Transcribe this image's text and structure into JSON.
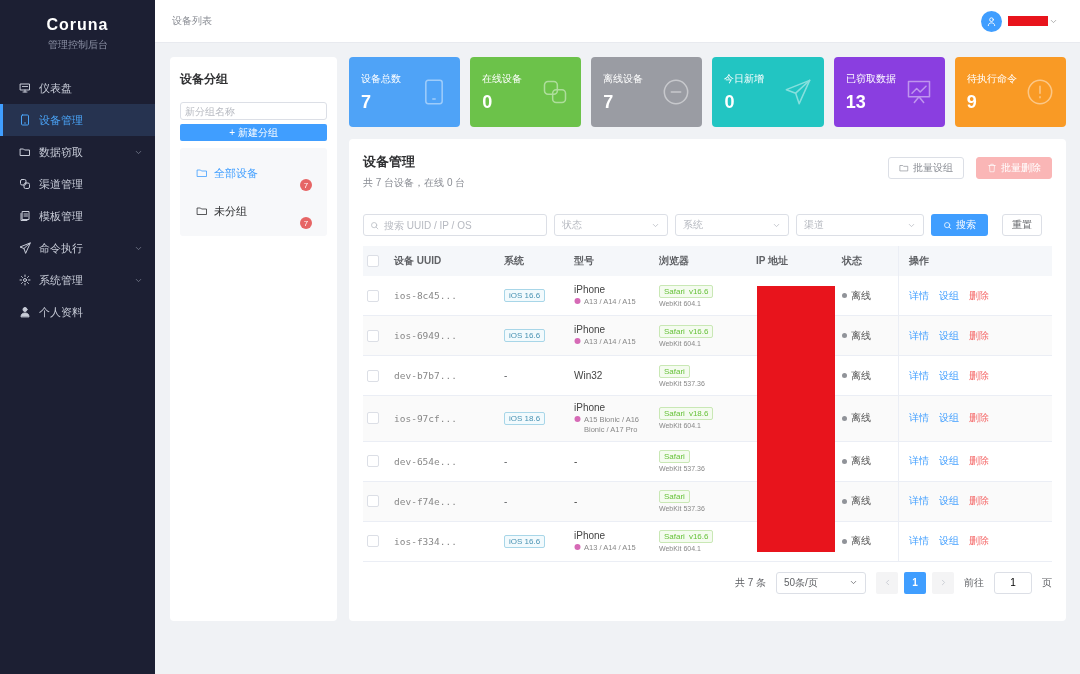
{
  "brand": {
    "title": "Coruna",
    "subtitle": "管理控制后台"
  },
  "sidebar": {
    "items": [
      {
        "label": "仪表盘",
        "selected": false,
        "expandable": false
      },
      {
        "label": "设备管理",
        "selected": true,
        "expandable": false
      },
      {
        "label": "数据窃取",
        "selected": false,
        "expandable": true
      },
      {
        "label": "渠道管理",
        "selected": false,
        "expandable": false
      },
      {
        "label": "模板管理",
        "selected": false,
        "expandable": false
      },
      {
        "label": "命令执行",
        "selected": false,
        "expandable": true
      },
      {
        "label": "系统管理",
        "selected": false,
        "expandable": true
      },
      {
        "label": "个人资料",
        "selected": false,
        "expandable": false
      }
    ]
  },
  "topbar": {
    "breadcrumb": "设备列表",
    "user_redacted": true
  },
  "groups": {
    "title": "设备分组",
    "input_placeholder": "新分组名称",
    "add_button": "+ 新建分组",
    "items": [
      {
        "label": "全部设备",
        "count": "7",
        "selected": true
      },
      {
        "label": "未分组",
        "count": "7",
        "selected": false
      }
    ]
  },
  "stats": [
    {
      "label": "设备总数",
      "value": "7",
      "color": "#4fa3f7"
    },
    {
      "label": "在线设备",
      "value": "0",
      "color": "#6cc24a"
    },
    {
      "label": "离线设备",
      "value": "7",
      "color": "#9a9ca3"
    },
    {
      "label": "今日新增",
      "value": "0",
      "color": "#22c5c2"
    },
    {
      "label": "已窃取数据",
      "value": "13",
      "color": "#8a3ee0"
    },
    {
      "label": "待执行命令",
      "value": "9",
      "color": "#f99a25"
    }
  ],
  "devices": {
    "title": "设备管理",
    "subtitle": "共 7 台设备，在线 0 台",
    "buttons": [
      {
        "label": "批量设组",
        "disabled": false,
        "kind": "plain"
      },
      {
        "label": "批量删除",
        "disabled": true,
        "kind": "danger"
      }
    ],
    "search_placeholder": "搜索 UUID / IP / OS",
    "filters": [
      {
        "placeholder": "状态"
      },
      {
        "placeholder": "系统"
      },
      {
        "placeholder": "渠道"
      }
    ],
    "search_button": "搜索",
    "reset_button": "重置",
    "columns": [
      "设备 UUID",
      "系统",
      "型号",
      "浏览器",
      "IP 地址",
      "状态",
      "操作"
    ],
    "header_checked": false,
    "ip_redacted": true,
    "rows": [
      {
        "checked": false,
        "uuid": "ios-8c45...",
        "os": "iOS 16.6",
        "model": "iPhone",
        "chips": "A13 / A14 / A15",
        "browser": "Safari",
        "version": "v16.6",
        "engine": "WebKit 604.1",
        "status": "离线",
        "color": "#909399",
        "actions": [
          "详情",
          "设组",
          "删除"
        ]
      },
      {
        "checked": false,
        "uuid": "ios-6949...",
        "os": "iOS 16.6",
        "model": "iPhone",
        "chips": "A13 / A14 / A15",
        "browser": "Safari",
        "version": "v16.6",
        "engine": "WebKit 604.1",
        "status": "离线",
        "color": "#909399",
        "actions": [
          "详情",
          "设组",
          "删除"
        ]
      },
      {
        "checked": false,
        "uuid": "dev-b7b7...",
        "os": "-",
        "model": "Win32",
        "browser": "Safari",
        "engine": "WebKit 537.36",
        "status": "离线",
        "color": "#909399",
        "actions": [
          "详情",
          "设组",
          "删除"
        ]
      },
      {
        "checked": false,
        "uuid": "ios-97cf...",
        "os": "iOS 18.6",
        "model": "iPhone",
        "chips": "A15 Bionic / A16 Bionic / A17 Pro",
        "browser": "Safari",
        "version": "v18.6",
        "engine": "WebKit 604.1",
        "status": "离线",
        "color": "#909399",
        "actions": [
          "详情",
          "设组",
          "删除"
        ]
      },
      {
        "checked": false,
        "uuid": "dev-654e...",
        "os": "-",
        "model": "-",
        "browser": "Safari",
        "engine": "WebKit 537.36",
        "status": "离线",
        "color": "#909399",
        "actions": [
          "详情",
          "设组",
          "删除"
        ]
      },
      {
        "checked": false,
        "uuid": "dev-f74e...",
        "os": "-",
        "model": "-",
        "browser": "Safari",
        "engine": "WebKit 537.36",
        "status": "离线",
        "color": "#909399",
        "actions": [
          "详情",
          "设组",
          "删除"
        ]
      },
      {
        "checked": false,
        "uuid": "ios-f334...",
        "os": "iOS 16.6",
        "model": "iPhone",
        "chips": "A13 / A14 / A15",
        "browser": "Safari",
        "version": "v16.6",
        "engine": "WebKit 604.1",
        "status": "离线",
        "color": "#909399",
        "actions": [
          "详情",
          "设组",
          "删除"
        ]
      }
    ],
    "pagination": {
      "total": "共 7 条",
      "page_size": "50条/页",
      "pages": [
        {
          "label": "1",
          "selected": true
        }
      ],
      "goto_label": "前往",
      "goto_value": "1",
      "goto_suffix": "页"
    }
  }
}
